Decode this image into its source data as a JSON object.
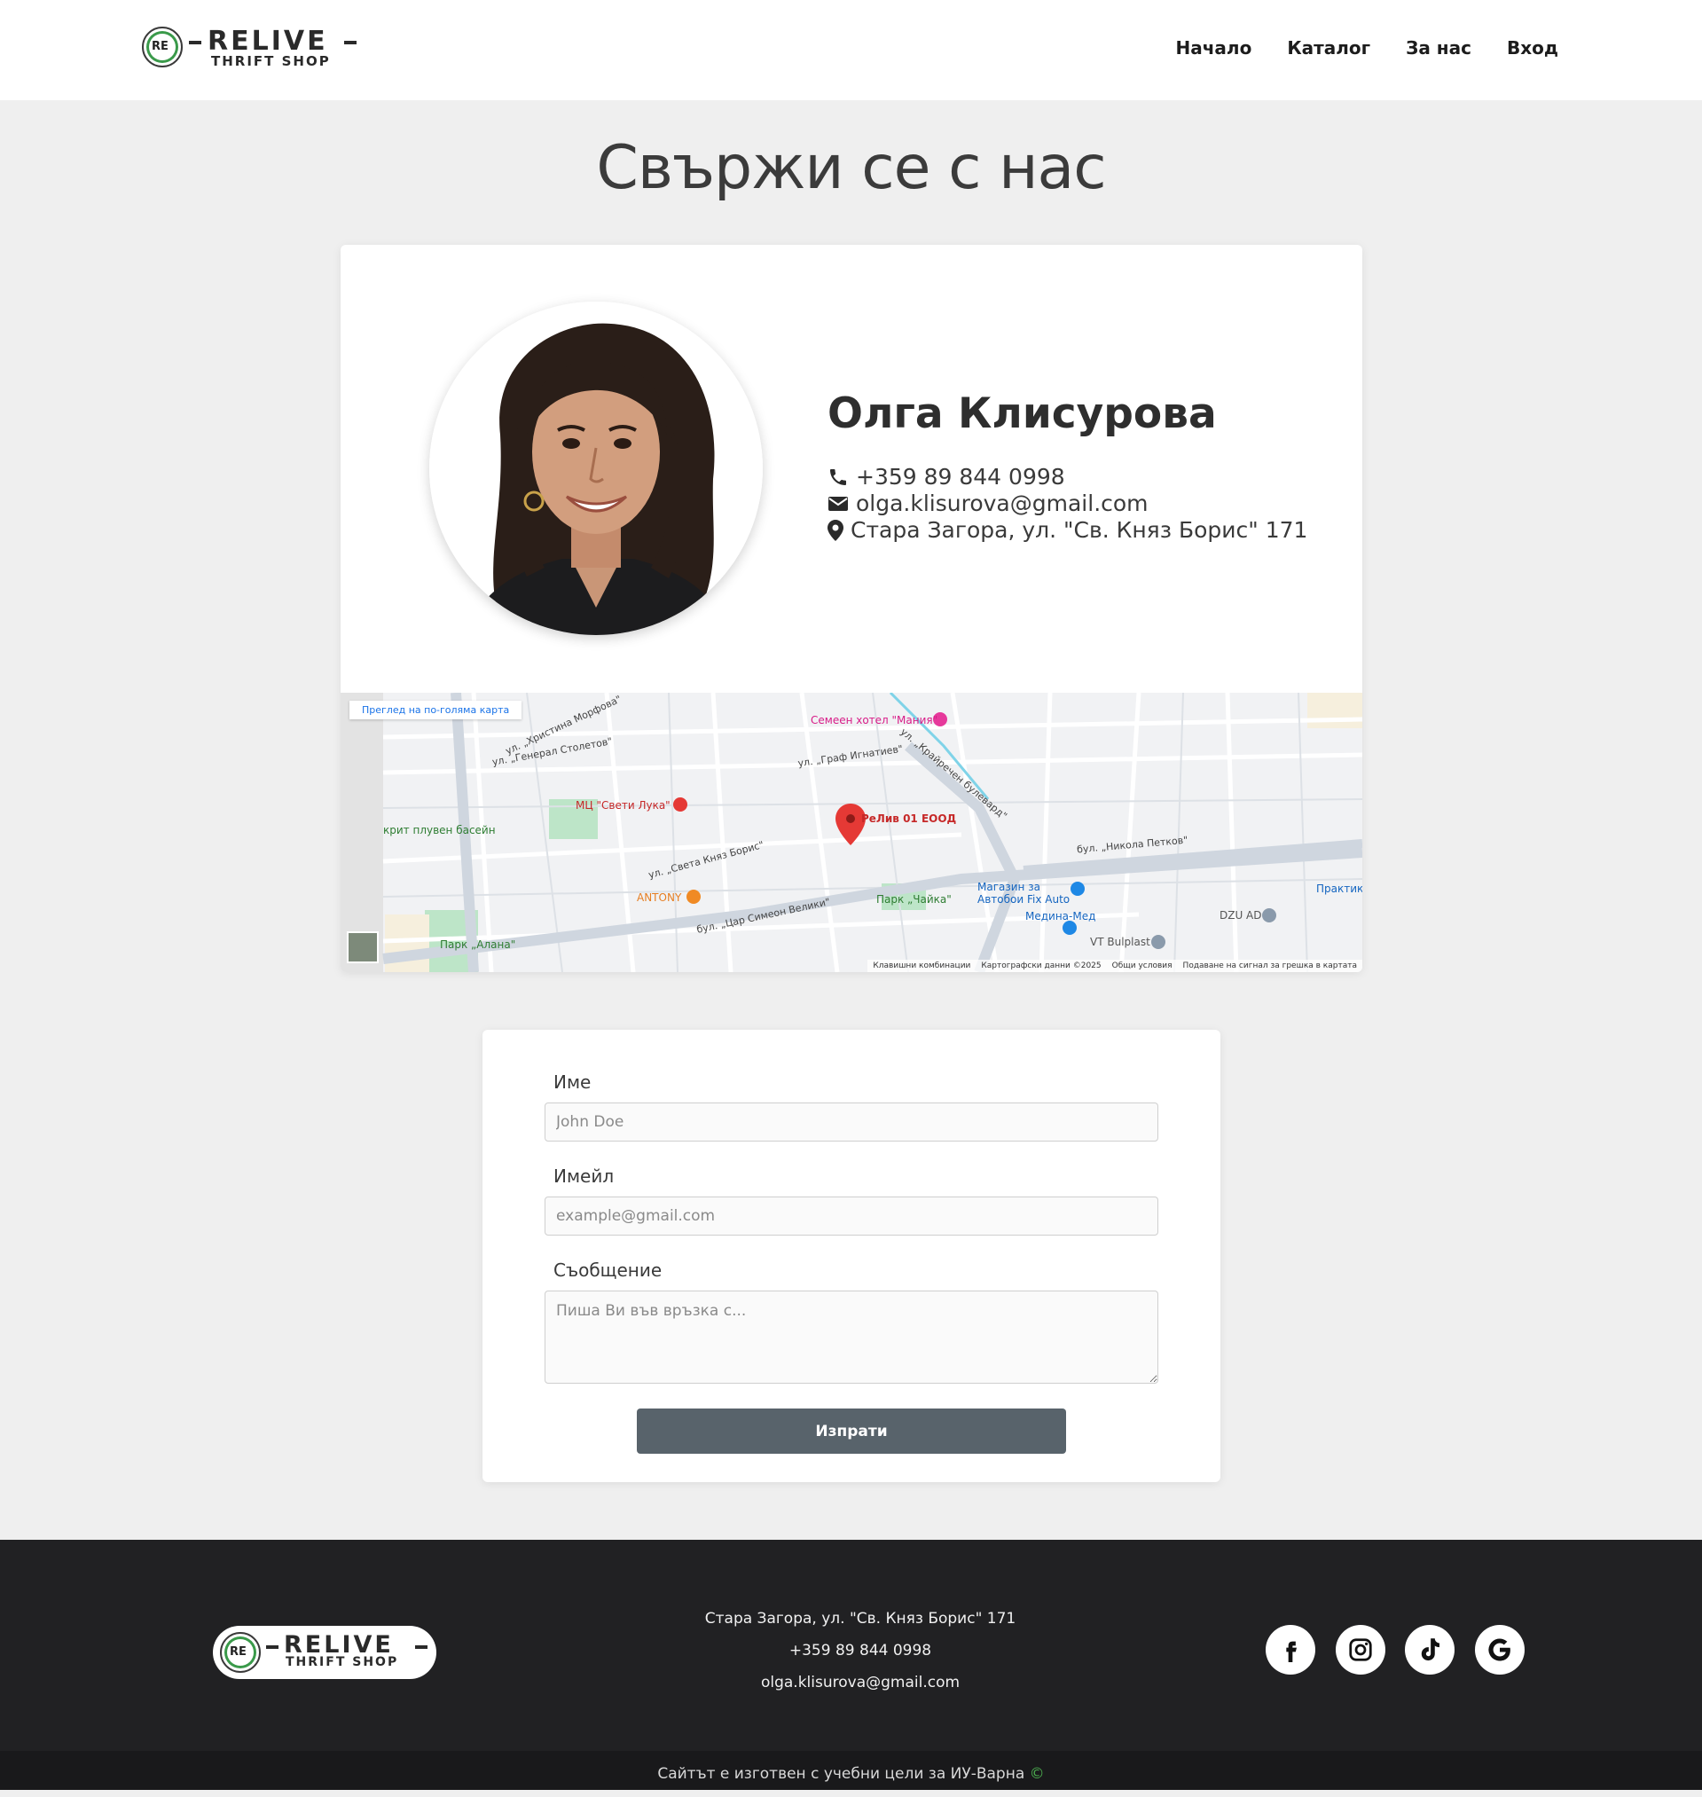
{
  "brand": {
    "name": "RELIVE",
    "tagline": "THRIFT SHOP",
    "mark": "RE"
  },
  "nav": {
    "items": [
      "Начало",
      "Каталог",
      "За нас",
      "Вход"
    ]
  },
  "page": {
    "title": "Свържи се с нас"
  },
  "contact": {
    "name": "Олга Клисурова",
    "phone": "+359 89 844 0998",
    "email": "olga.klisurova@gmail.com",
    "address": "Стара Загора, ул. \"Св. Княз Борис\" 171"
  },
  "map": {
    "view_larger": "Преглед на по-голяма карта",
    "marker_label": "РеЛив 01 ЕООД",
    "places": {
      "hotel": "Семеен хотел \"Мания\"",
      "hospital": "МЦ \"Свети Лука\"",
      "pool": "крит плувен басейн",
      "restaurant": "ANTONY",
      "park_chaika": "Парк „Чайка\"",
      "park_alana": "Парк „Алана\"",
      "shop1": "Магазин за Автобои Fix Auto",
      "pharmacy": "Медина-Мед",
      "vt": "VT Bulplast",
      "dzu": "DZU AD",
      "praktiker": "Практикер"
    },
    "streets": {
      "s1": "ул. „Генерал Столетов\"",
      "s2": "ул. „Христина Морфова\"",
      "s3": "ул. „Граф Игнатиев\"",
      "s4": "ул. „Света Княз Борис\"",
      "s5": "бул. „Цар Симеон Велики\"",
      "s6": "бул. „Никола Петков\"",
      "s7": "ул. „Крайречен булевард\""
    },
    "footer": [
      "Клавишни комбинации",
      "Картографски данни ©2025",
      "Общи условия",
      "Подаване на сигнал за грешка в картата"
    ]
  },
  "form": {
    "name_label": "Име",
    "name_placeholder": "John Doe",
    "email_label": "Имейл",
    "email_placeholder": "example@gmail.com",
    "message_label": "Съобщение",
    "message_placeholder": "Пиша Ви във връзка с...",
    "submit_label": "Изпрати"
  },
  "footer": {
    "address": "Стара Загора, ул. \"Св. Княз Борис\" 171",
    "phone": "+359 89 844 0998",
    "email": "olga.klisurova@gmail.com",
    "social_icons": [
      "facebook-icon",
      "instagram-icon",
      "tiktok-icon",
      "google-icon"
    ],
    "bottom_text": "Сайтът е изготвен с учебни цели за ИУ-Варна",
    "copyright_symbol": "©"
  },
  "colors": {
    "accent": "#58636b",
    "footer_bg": "#212123",
    "pin": "#e53935"
  }
}
